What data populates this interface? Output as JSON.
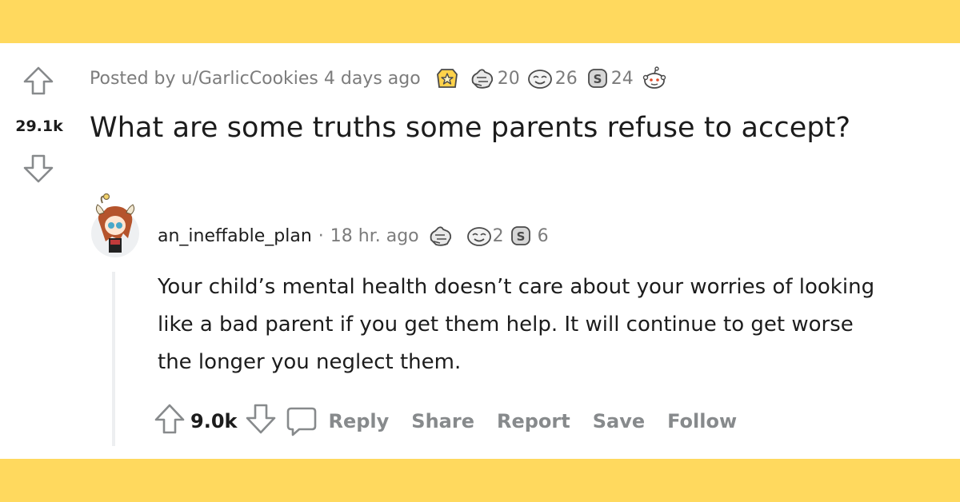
{
  "post": {
    "meta": "Posted by u/GarlicCookies 4 days ago",
    "awards": [
      {
        "icon": "gold-award-icon",
        "count": ""
      },
      {
        "icon": "wholesome-award-icon",
        "count": "20"
      },
      {
        "icon": "helpful-award-icon",
        "count": "26"
      },
      {
        "icon": "silver-award-icon",
        "count": "24"
      },
      {
        "icon": "snoo-award-icon",
        "count": ""
      }
    ],
    "score": "29.1k",
    "title": "What are some truths some parents refuse to accept?"
  },
  "comment": {
    "author": "an_ineffable_plan",
    "separator": "·",
    "time": "18 hr. ago",
    "awards": [
      {
        "icon": "wholesome-award-icon",
        "count": ""
      },
      {
        "icon": "helpful-award-icon",
        "count": "2"
      },
      {
        "icon": "silver-award-icon",
        "count": "6"
      }
    ],
    "body": "Your child’s mental health doesn’t care about your worries of looking like a bad parent if you get them help. It will continue to get worse the longer you neglect them.",
    "score": "9.0k",
    "actions": {
      "reply": "Reply",
      "share": "Share",
      "report": "Report",
      "save": "Save",
      "follow": "Follow"
    }
  },
  "colors": {
    "banner": "#ffd95e",
    "text": "#1c1c1c",
    "muted": "#7c7c7c",
    "action": "#878a8c"
  }
}
